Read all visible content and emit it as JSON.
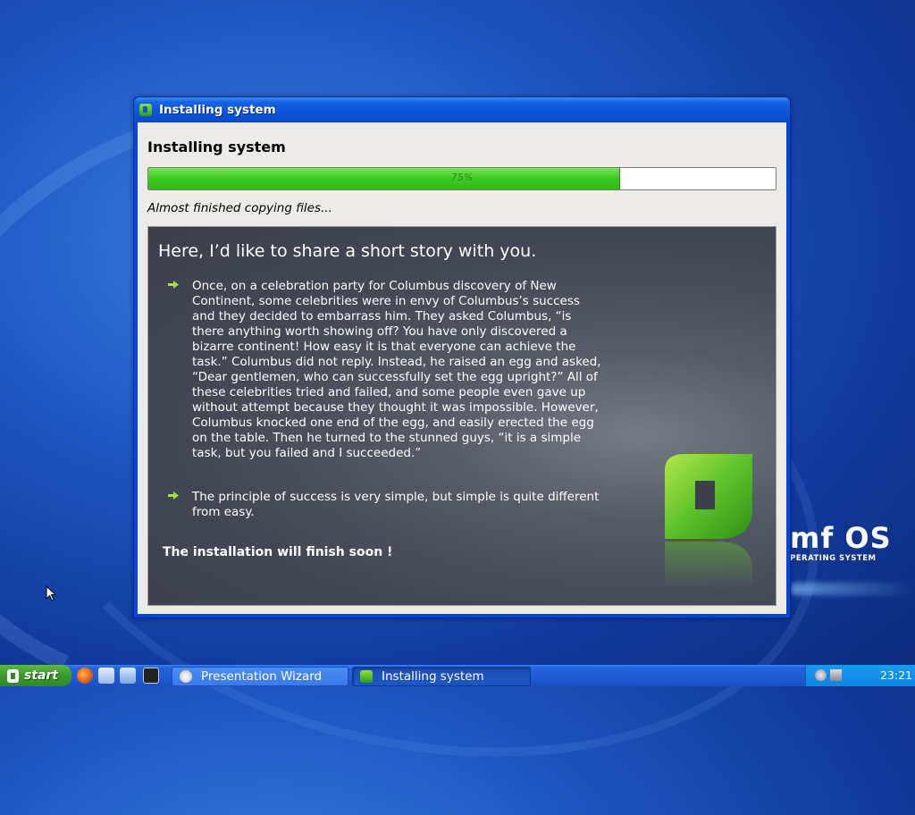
{
  "desktop": {
    "brand_name": "mf OS",
    "brand_subtitle": "PERATING SYSTEM"
  },
  "window": {
    "title": "Installing system",
    "heading": "Installing system",
    "progress_percent": 75,
    "progress_label": "75%",
    "status": "Almost finished copying files...",
    "slide": {
      "title": "Here, I’d like to share a short story with you.",
      "bullets": [
        "Once, on a celebration party for Columbus discovery of New Continent, some celebrities were in envy of Columbus’s success and they decided to embarrass him. They asked Columbus, “is there anything worth showing off? You have only discovered a bizarre continent! How easy it is that everyone can achieve the task.” Columbus did not reply. Instead, he raised an egg and asked, “Dear gentlemen, who can successfully set the egg upright?” All of these celebrities tried and failed, and some people even gave up without attempt because they thought it was impossible. However, Columbus knocked one end of the egg, and easily erected the egg on the table. Then he turned to the stunned guys, “it is a simple task, but you failed and I succeeded.”",
        "The principle of success is very simple, but simple is quite different from easy."
      ],
      "footer": "The installation will finish soon !"
    }
  },
  "taskbar": {
    "start_label": "start",
    "tasks": [
      {
        "label": "Presentation Wizard"
      },
      {
        "label": "Installing system"
      }
    ],
    "clock": "23:21"
  },
  "colors": {
    "desktop_blue": "#1f58c4",
    "progress_green": "#3fcc24",
    "slide_bg": "#434754",
    "taskbar_blue": "#215bd2",
    "start_green": "#3c9a2c"
  }
}
